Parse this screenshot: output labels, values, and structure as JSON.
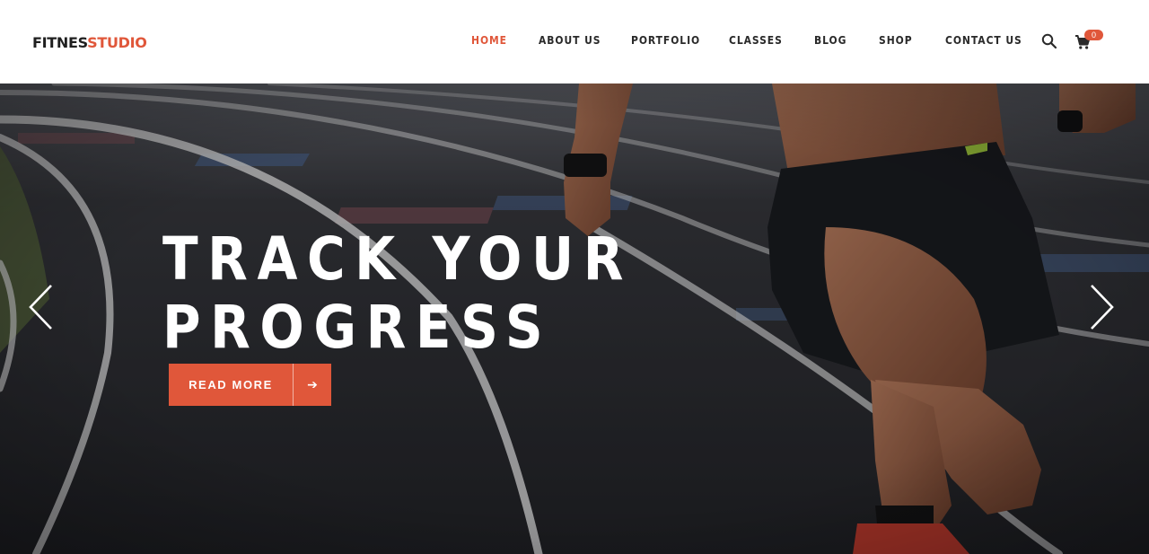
{
  "logo": {
    "part1": "FITNES",
    "part2": "STUDIO"
  },
  "nav": {
    "items": [
      {
        "label": "HOME"
      },
      {
        "label": "ABOUT US"
      },
      {
        "label": "PORTFOLIO"
      },
      {
        "label": "CLASSES"
      },
      {
        "label": "BLOG"
      },
      {
        "label": "SHOP"
      },
      {
        "label": "CONTACT US"
      }
    ],
    "active_item": "HOME"
  },
  "icons": {
    "search": "search-icon",
    "cart": "cart-icon",
    "prev": "chevron-left-icon",
    "next": "chevron-right-icon",
    "read_more": "arrow-right-icon"
  },
  "cart": {
    "count": "0"
  },
  "hero": {
    "title_line1": "TRACK YOUR",
    "title_line2": "PROGRESS",
    "button_label": "READ MORE",
    "button_arrow": "➔"
  },
  "colors": {
    "accent": "#e0573a",
    "text_dark": "#2a2a2a",
    "white": "#ffffff"
  }
}
